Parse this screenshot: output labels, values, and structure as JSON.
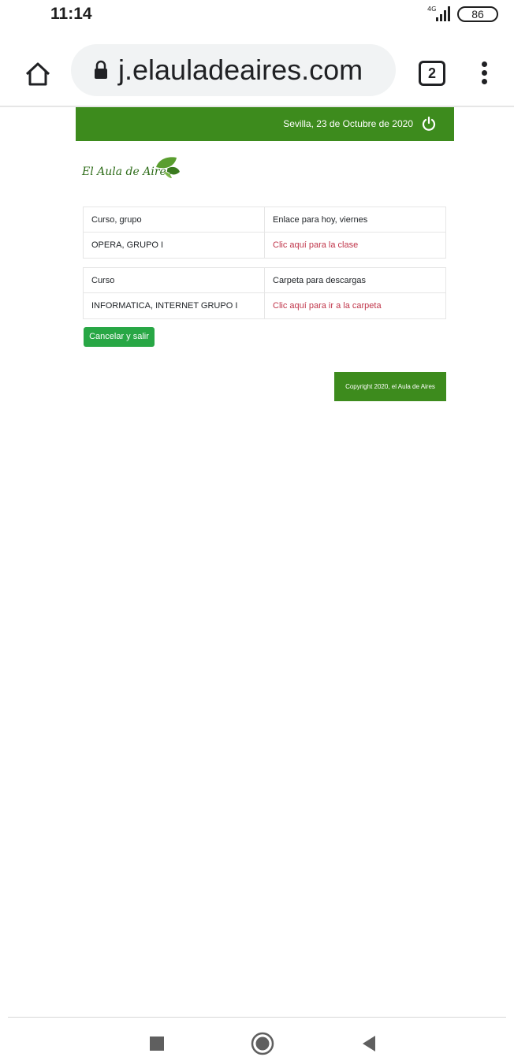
{
  "status": {
    "time": "11:14",
    "network": "4G",
    "battery": "86"
  },
  "browser": {
    "url": "j.elauladeaires.com",
    "tab_count": "2"
  },
  "header": {
    "date": "Sevilla, 23 de Octubre de 2020"
  },
  "logo": {
    "text": "El Aula de Aires"
  },
  "table1": {
    "headers": [
      "Curso, grupo",
      "Enlace para hoy, viernes"
    ],
    "rows": [
      [
        "OPERA, GRUPO I",
        "Clic aquí para la clase"
      ]
    ]
  },
  "table2": {
    "headers": [
      "Curso",
      "Carpeta para descargas"
    ],
    "rows": [
      [
        "INFORMATICA, INTERNET GRUPO I",
        "Clic aquí para ir a la carpeta"
      ]
    ]
  },
  "actions": {
    "cancel_label": "Cancelar y salir"
  },
  "footer": {
    "text": "Copyright 2020, el Aula de Aires"
  },
  "colors": {
    "brand_green": "#3d8b1d",
    "button_green": "#28a745",
    "link_red": "#c0354a"
  }
}
